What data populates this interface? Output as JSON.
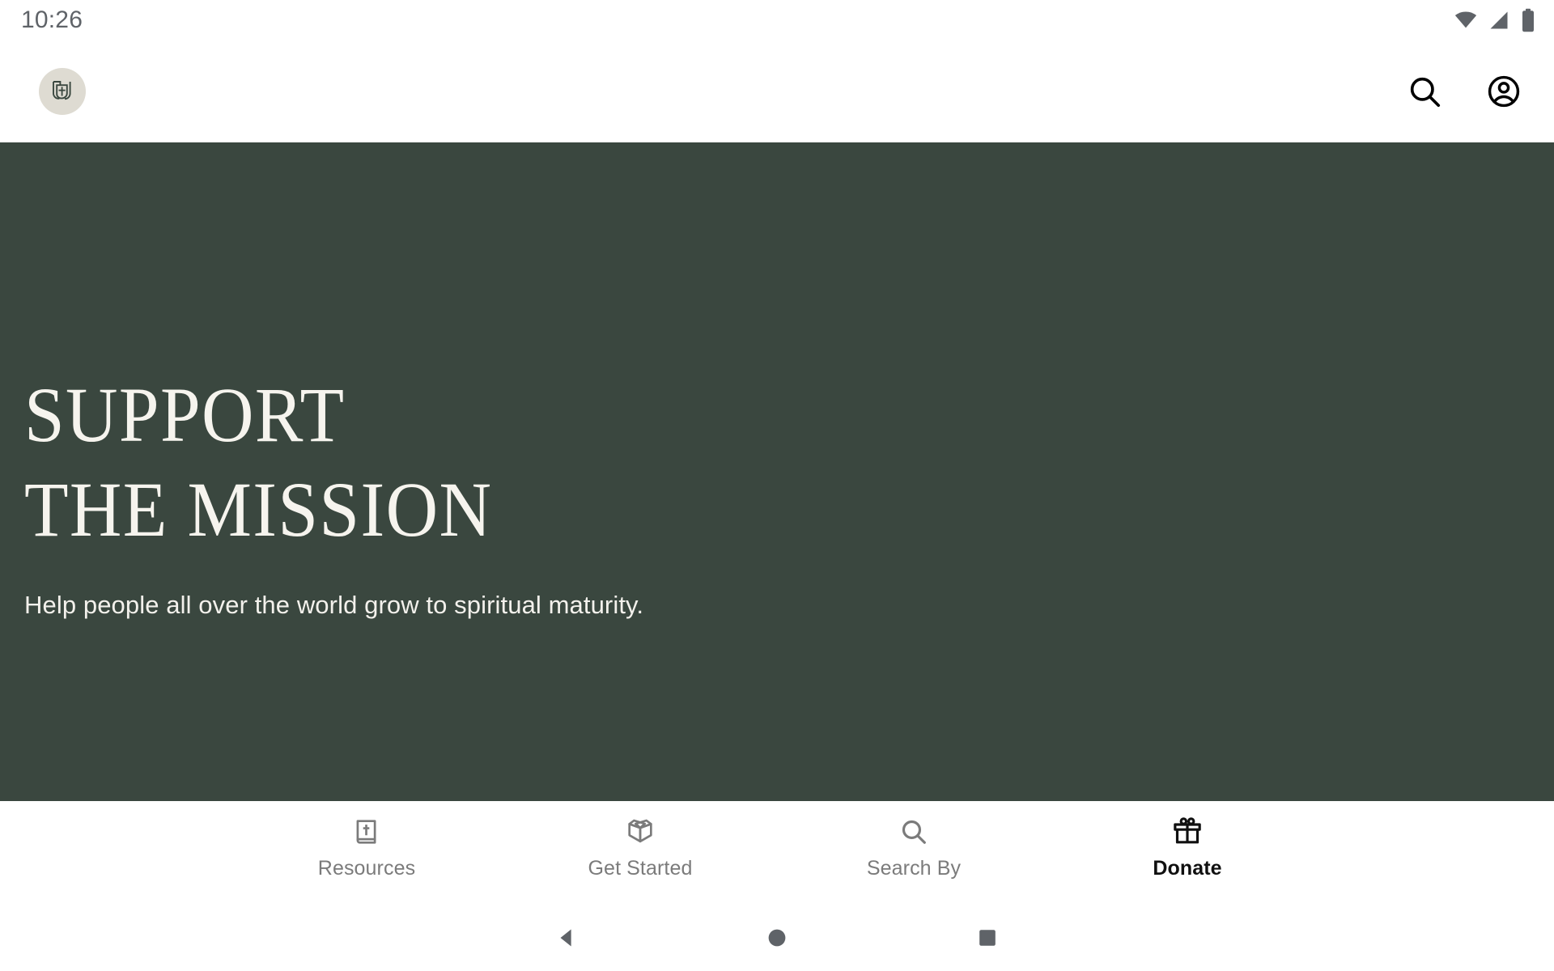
{
  "status_bar": {
    "time": "10:26",
    "icons": [
      "wifi-icon",
      "cellular-signal-icon",
      "battery-icon"
    ]
  },
  "header": {
    "logo_name": "app-logo-shield-cross",
    "actions": [
      {
        "name": "search-icon",
        "label": "Search"
      },
      {
        "name": "account-circle-icon",
        "label": "Account"
      }
    ]
  },
  "hero": {
    "title_line1": "SUPPORT",
    "title_line2": "THE MISSION",
    "subtitle": "Help people all over the world grow to spiritual maturity.",
    "background_color": "#3A473F",
    "text_color": "#F6F4EE"
  },
  "bottom_nav": {
    "tabs": [
      {
        "label": "Resources",
        "icon": "bible-book-cross-icon",
        "active": false
      },
      {
        "label": "Get Started",
        "icon": "open-box-icon",
        "active": false
      },
      {
        "label": "Search By",
        "icon": "search-icon",
        "active": false
      },
      {
        "label": "Donate",
        "icon": "gift-box-icon",
        "active": true
      }
    ],
    "active_color": "#101010",
    "inactive_color": "#7B7B7B"
  },
  "android_nav": {
    "buttons": [
      {
        "name": "back-button",
        "icon": "triangle-left-icon"
      },
      {
        "name": "home-button",
        "icon": "circle-icon"
      },
      {
        "name": "recents-button",
        "icon": "square-icon"
      }
    ],
    "color": "#5F6368"
  }
}
